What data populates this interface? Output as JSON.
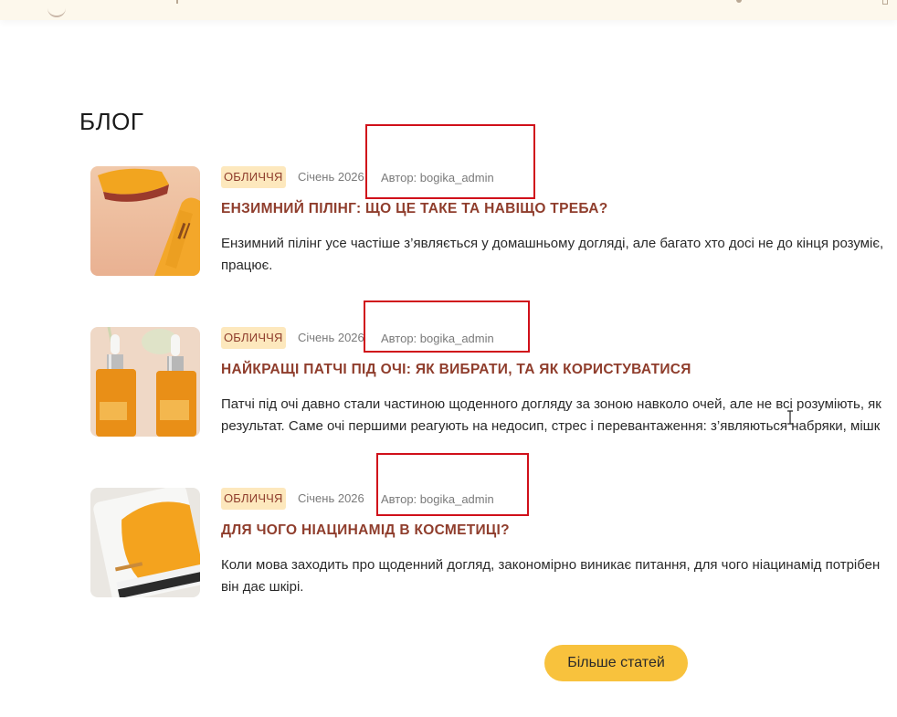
{
  "blog": {
    "title": "БЛОГ",
    "more_button_label": "Більше статей",
    "posts": [
      {
        "image": "vitamin-c-serum-tube-with-mango-photo",
        "category": "ОБЛИЧЧЯ",
        "date": "Січень 2026",
        "author": "Автор: bogika_admin",
        "title": "ЕНЗИМНИЙ ПІЛІНГ: ЩО ЦЕ ТАКЕ ТА НАВІЩО ТРЕБА?",
        "excerpt_lines": [
          "Ензимний пілінг усе частіше з’являється у домашньому догляді, але багато хто досі не до кінця розуміє,",
          "працює."
        ]
      },
      {
        "image": "eye-patch-jars-with-droppers-photo",
        "category": "ОБЛИЧЧЯ",
        "date": "Січень 2026",
        "author": "Автор: bogika_admin",
        "title": "НАЙКРАЩІ ПАТЧІ ПІД ОЧІ: ЯК ВИБРАТИ, ТА ЯК КОРИСТУВАТИСЯ",
        "excerpt_lines": [
          "Патчі під очі давно стали частиною щоденного догляду за зоною навколо очей, але не всі розуміють, як",
          "результат. Саме очі першими реагують на недосип, стрес і перевантаження: з’являються набряки, мішк"
        ]
      },
      {
        "image": "hyaluronic-eye-contour-cream-tube-photo",
        "category": "ОБЛИЧЧЯ",
        "date": "Січень 2026",
        "author": "Автор: bogika_admin",
        "title": "ДЛЯ ЧОГО НІАЦИНАМІД В КОСМЕТИЦІ?",
        "excerpt_lines": [
          "Коли мова заходить про щоденний догляд, закономірно виникає питання, для чого ніацинамід потрібен",
          "він дає шкірі."
        ]
      }
    ]
  },
  "colors": {
    "accent_title": "#8f3d2c",
    "badge_bg": "#fde8bd",
    "button_bg": "#f8c23d",
    "highlight_border": "#d0101a",
    "header_bg": "#fdf8ec"
  }
}
